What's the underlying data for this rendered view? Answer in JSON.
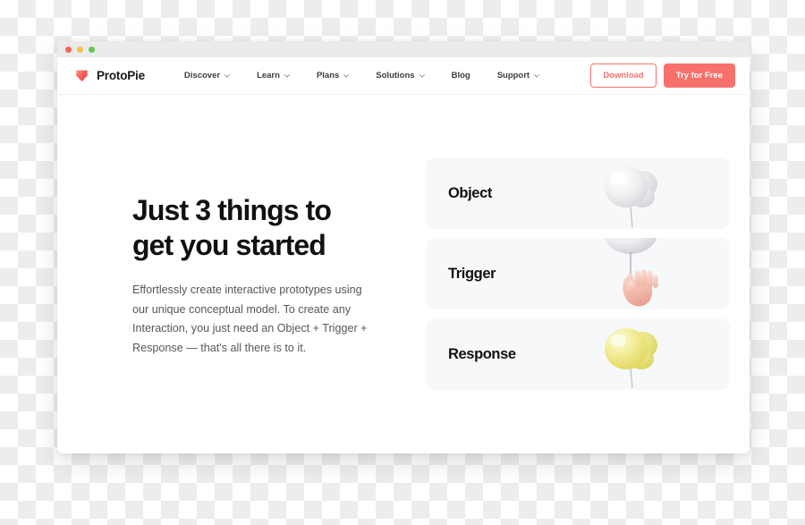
{
  "window": {
    "traffic_lights": [
      {
        "name": "close",
        "color": "#f5645f"
      },
      {
        "name": "minimize",
        "color": "#f7c046"
      },
      {
        "name": "maximize",
        "color": "#5fc956"
      }
    ]
  },
  "nav": {
    "brand": "ProtoPie",
    "logo_icon": "protopie-triangle-logo",
    "links": [
      {
        "label": "Discover",
        "has_dropdown": true
      },
      {
        "label": "Learn",
        "has_dropdown": true
      },
      {
        "label": "Plans",
        "has_dropdown": true
      },
      {
        "label": "Solutions",
        "has_dropdown": true
      },
      {
        "label": "Blog",
        "has_dropdown": false
      },
      {
        "label": "Support",
        "has_dropdown": true
      }
    ],
    "download_label": "Download",
    "try_free_label": "Try for Free"
  },
  "hero": {
    "heading": "Just 3 things to\nget you started",
    "paragraph": "Effortlessly create interactive prototypes using our unique conceptual model. To create any Interaction, you just need an Object + Trigger + Response — that's all there is to it."
  },
  "cards": [
    {
      "label": "Object",
      "art": "white-balloon-icon"
    },
    {
      "label": "Trigger",
      "art": "hand-grabbing-balloon-string-icon"
    },
    {
      "label": "Response",
      "art": "yellow-balloon-icon"
    }
  ],
  "colors": {
    "accent": "#f8706c",
    "heading": "#111114",
    "body_text": "#55575c",
    "card_bg": "#f7f8fa",
    "titlebar_bg": "#ebebeb",
    "balloon_white": "#e4e5e7",
    "balloon_yellow": "#ede67c"
  }
}
